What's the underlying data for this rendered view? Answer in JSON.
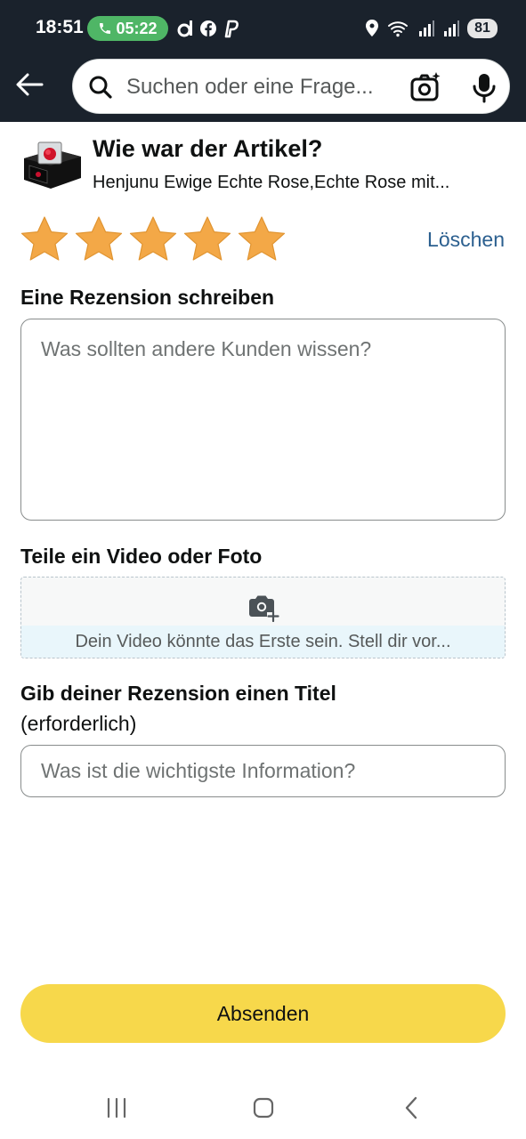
{
  "status_bar": {
    "time": "18:51",
    "call_timer": "05:22",
    "battery": "81"
  },
  "search": {
    "placeholder": "Suchen oder eine Frage..."
  },
  "product": {
    "question": "Wie war der Artikel?",
    "name": "Henjunu Ewige Echte Rose,Echte Rose mit..."
  },
  "rating": {
    "value": 5,
    "max": 5,
    "star_color": "#f3a847",
    "clear_label": "Löschen"
  },
  "review": {
    "label": "Eine Rezension schreiben",
    "placeholder": "Was sollten andere Kunden wissen?"
  },
  "media": {
    "label": "Teile ein Video oder Foto",
    "hint": "Dein Video könnte das Erste sein. Stell dir vor..."
  },
  "title": {
    "label": "Gib deiner Rezension einen Titel",
    "required_note": "(erforderlich)",
    "placeholder": "Was ist die wichtigste Information?"
  },
  "submit_label": "Absenden",
  "colors": {
    "header_bg": "#1a222c",
    "submit_bg": "#f7d84b",
    "link": "#2b5f8f",
    "call_pill": "#4fb666"
  }
}
